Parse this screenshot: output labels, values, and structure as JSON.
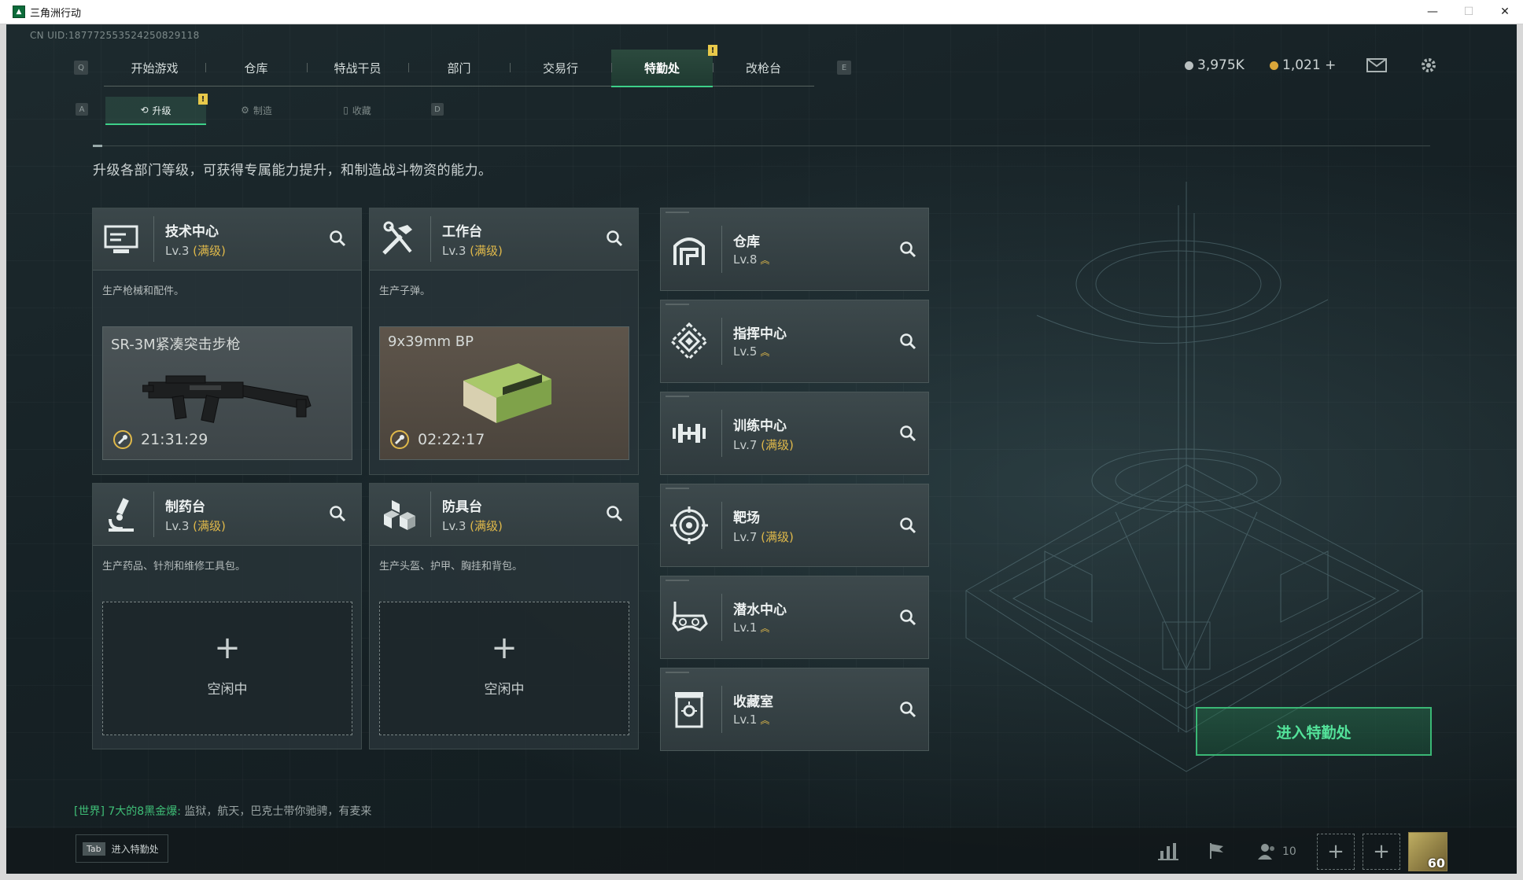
{
  "window": {
    "title": "三角洲行动"
  },
  "uid": "CN UID:1877725535242508291​18",
  "topnav": {
    "left_key": "Q",
    "right_key": "E",
    "tabs": [
      "开始游戏",
      "仓库",
      "特战干员",
      "部门",
      "交易行",
      "特勤处",
      "改枪台"
    ],
    "active": "特勤处",
    "alert": "!"
  },
  "currency": {
    "silver": "3,975K",
    "gold": "1,021 +"
  },
  "subnav": {
    "left_key": "A",
    "right_key": "D",
    "tabs": [
      "升级",
      "制造",
      "收藏"
    ],
    "alert": "!"
  },
  "description": "升级各部门等级，可获得专属能力提升，和制造战斗物资的能力。",
  "cards": [
    {
      "name": "技术中心",
      "level": "Lv.3",
      "max": "(满级)",
      "sub": "生产枪械和配件。",
      "item": "SR-3M紧凑突击步枪",
      "timer": "21:31:29",
      "icon": "monitor-icon"
    },
    {
      "name": "工作台",
      "level": "Lv.3",
      "max": "(满级)",
      "sub": "生产子弹。",
      "item": "9x39mm BP",
      "timer": "02:22:17",
      "icon": "tools-icon"
    },
    {
      "name": "制药台",
      "level": "Lv.3",
      "max": "(满级)",
      "sub": "生产药品、针剂和维修工具包。",
      "plus": "+",
      "idle": "空闲中",
      "icon": "microscope-icon"
    },
    {
      "name": "防具台",
      "level": "Lv.3",
      "max": "(满级)",
      "sub": "生产头盔、护甲、胸挂和背包。",
      "plus": "+",
      "idle": "空闲中",
      "icon": "armor-blocks-icon"
    }
  ],
  "facilities": [
    {
      "name": "仓库",
      "level": "Lv.8",
      "max": "",
      "up": "︽",
      "icon": "warehouse-icon"
    },
    {
      "name": "指挥中心",
      "level": "Lv.5",
      "max": "",
      "up": "︽",
      "icon": "command-icon"
    },
    {
      "name": "训练中心",
      "level": "Lv.7",
      "max": "(满级)",
      "up": "",
      "icon": "dumbbell-icon"
    },
    {
      "name": "靶场",
      "level": "Lv.7",
      "max": "(满级)",
      "up": "",
      "icon": "target-icon"
    },
    {
      "name": "潜水中心",
      "level": "Lv.1",
      "max": "",
      "up": "︽",
      "icon": "diving-mask-icon"
    },
    {
      "name": "收藏室",
      "level": "Lv.1",
      "max": "",
      "up": "︽",
      "icon": "trophy-case-icon"
    }
  ],
  "enter_button": "进入特勤处",
  "chat": {
    "channel": "[世界] 7大的8黑金爆:",
    "message": " 监狱，航天，巴克士带你驰骋，有麦来"
  },
  "bottom": {
    "tab_key": "Tab",
    "tab_label": "进入特勤处",
    "friends": "10",
    "level": "60",
    "plus": "+"
  },
  "colors": {
    "accent": "#3dd089",
    "max_level": "#e0b94a",
    "alert": "#e8c94a"
  }
}
